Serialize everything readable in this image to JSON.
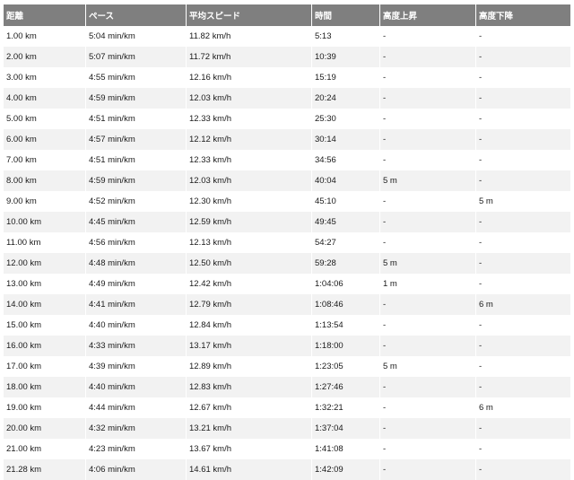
{
  "table": {
    "headers": [
      "距離",
      "ペース",
      "平均スピード",
      "時間",
      "高度上昇",
      "高度下降"
    ],
    "rows": [
      [
        "1.00 km",
        "5:04 min/km",
        "11.82 km/h",
        "5:13",
        "-",
        "-"
      ],
      [
        "2.00 km",
        "5:07 min/km",
        "11.72 km/h",
        "10:39",
        "-",
        "-"
      ],
      [
        "3.00 km",
        "4:55 min/km",
        "12.16 km/h",
        "15:19",
        "-",
        "-"
      ],
      [
        "4.00 km",
        "4:59 min/km",
        "12.03 km/h",
        "20:24",
        "-",
        "-"
      ],
      [
        "5.00 km",
        "4:51 min/km",
        "12.33 km/h",
        "25:30",
        "-",
        "-"
      ],
      [
        "6.00 km",
        "4:57 min/km",
        "12.12 km/h",
        "30:14",
        "-",
        "-"
      ],
      [
        "7.00 km",
        "4:51 min/km",
        "12.33 km/h",
        "34:56",
        "-",
        "-"
      ],
      [
        "8.00 km",
        "4:59 min/km",
        "12.03 km/h",
        "40:04",
        "5 m",
        "-"
      ],
      [
        "9.00 km",
        "4:52 min/km",
        "12.30 km/h",
        "45:10",
        "-",
        "5 m"
      ],
      [
        "10.00 km",
        "4:45 min/km",
        "12.59 km/h",
        "49:45",
        "-",
        "-"
      ],
      [
        "11.00 km",
        "4:56 min/km",
        "12.13 km/h",
        "54:27",
        "-",
        "-"
      ],
      [
        "12.00 km",
        "4:48 min/km",
        "12.50 km/h",
        "59:28",
        "5 m",
        "-"
      ],
      [
        "13.00 km",
        "4:49 min/km",
        "12.42 km/h",
        "1:04:06",
        "1 m",
        "-"
      ],
      [
        "14.00 km",
        "4:41 min/km",
        "12.79 km/h",
        "1:08:46",
        "-",
        "6 m"
      ],
      [
        "15.00 km",
        "4:40 min/km",
        "12.84 km/h",
        "1:13:54",
        "-",
        "-"
      ],
      [
        "16.00 km",
        "4:33 min/km",
        "13.17 km/h",
        "1:18:00",
        "-",
        "-"
      ],
      [
        "17.00 km",
        "4:39 min/km",
        "12.89 km/h",
        "1:23:05",
        "5 m",
        "-"
      ],
      [
        "18.00 km",
        "4:40 min/km",
        "12.83 km/h",
        "1:27:46",
        "-",
        "-"
      ],
      [
        "19.00 km",
        "4:44 min/km",
        "12.67 km/h",
        "1:32:21",
        "-",
        "6 m"
      ],
      [
        "20.00 km",
        "4:32 min/km",
        "13.21 km/h",
        "1:37:04",
        "-",
        "-"
      ],
      [
        "21.00 km",
        "4:23 min/km",
        "13.67 km/h",
        "1:41:08",
        "-",
        "-"
      ],
      [
        "21.28 km",
        "4:06 min/km",
        "14.61 km/h",
        "1:42:09",
        "-",
        "-"
      ]
    ]
  },
  "colors": {
    "header_bg": "#7f7f7f",
    "header_text": "#ffffff",
    "row_alt_bg": "#f2f2f2",
    "row_bg": "#ffffff"
  }
}
